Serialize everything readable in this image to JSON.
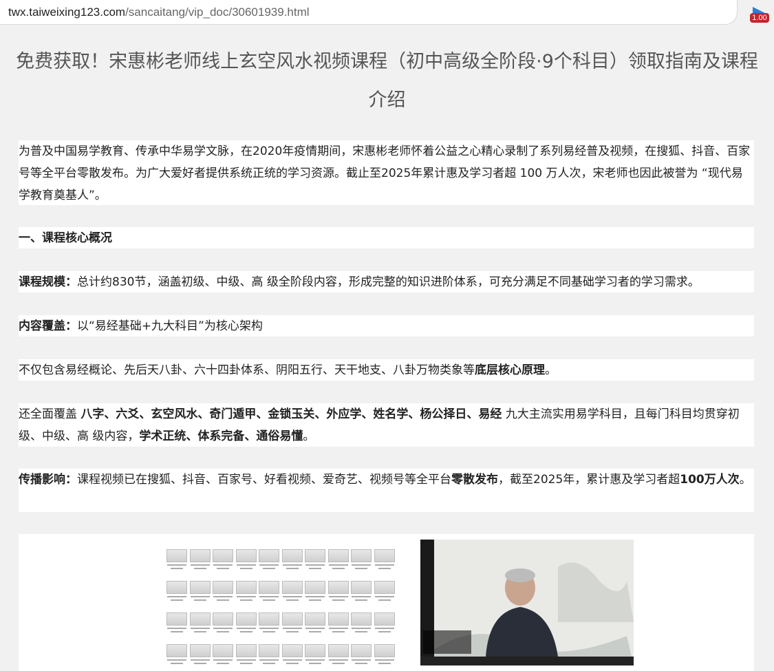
{
  "browser": {
    "url_host": "twx.taiweixing123.com",
    "url_path": "/sancaitang/vip_doc/30601939.html",
    "extension_badge": "1.00"
  },
  "article": {
    "title": "免费获取！宋惠彬老师线上玄空风水视频课程（初中高级全阶段·9个科目）领取指南及课程介绍",
    "intro": "为普及中国易学教育、传承中华易学文脉，在2020年疫情期间，宋惠彬老师怀着公益之心精心录制了系列易经普及视频，在搜狐、抖音、百家号等全平台零散发布。为广大爱好者提供系统正统的学习资源。截止至2025年累计惠及学习者超 100 万人次，宋老师也因此被誉为 “现代易学教育奠基人”。",
    "section1_heading": "一、课程核心概况",
    "scale_label": "课程规模：",
    "scale_text": "总计约830节，涵盖初级、中级、高 级全阶段内容，形成完整的知识进阶体系，可充分满足不同基础学习者的学习需求。",
    "coverage_label": "内容覆盖：",
    "coverage_text": "以“易经基础+九大科目”为核心架构",
    "principles_text": "不仅包含易经概论、先后天八卦、六十四卦体系、阴阳五行、天干地支、八卦万物类象等",
    "principles_bold": "底层核心原理",
    "principles_end": "。",
    "subjects_prefix": "还全面覆盖 ",
    "subjects_bold": "八字、六爻、玄空风水、奇门遁甲、金锁玉关、外应学、姓名学、杨公择日、易经",
    "subjects_mid": " 九大主流实用易学科目，且每门科目均贯穿初级、中级、高 级内容，",
    "subjects_bold2": "学术正统、体系完备、通俗易懂",
    "subjects_end": "。",
    "impact_label": "传播影响：",
    "impact_text": "课程视频已在搜狐、抖音、百家号、好看视频、爱奇艺、视频号等全平台",
    "impact_bold": "零散发布",
    "impact_text2": "，截至2025年，累计惠及学习者超",
    "impact_bold2": "100万人次",
    "impact_end": "。"
  },
  "images": {
    "left_alt": "video-file-grid",
    "right_alt": "lecture-video-frame"
  }
}
